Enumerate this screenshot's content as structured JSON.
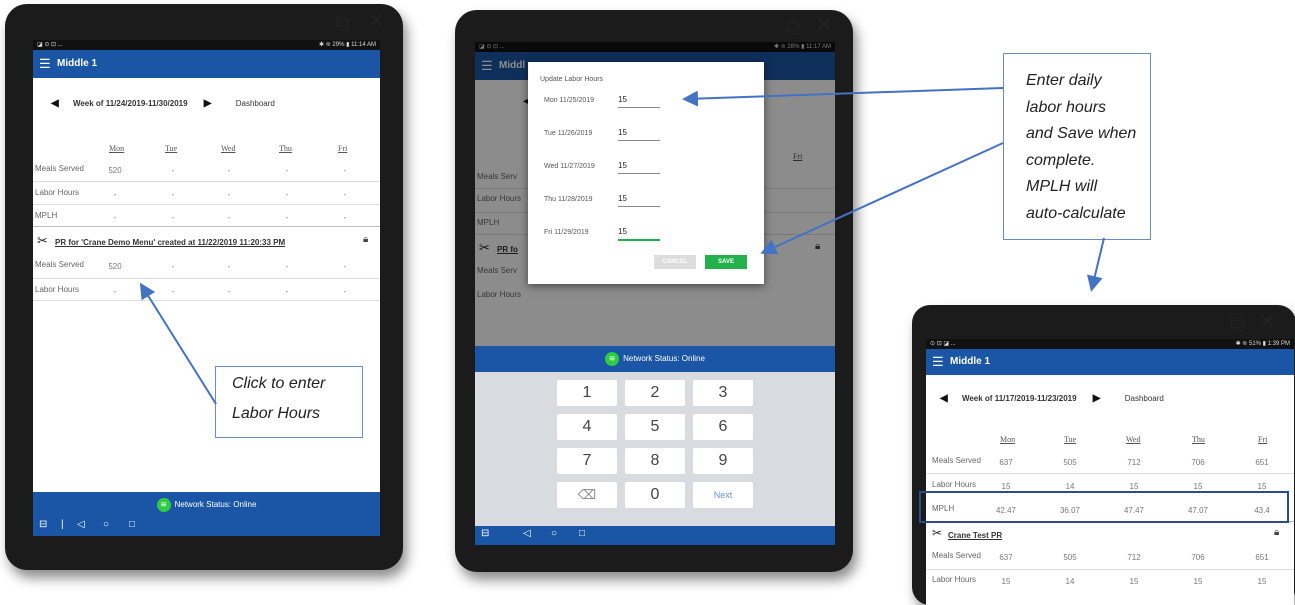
{
  "ext_icon": "external-link-icon",
  "close_icon": "close-x-icon",
  "panel1": {
    "status_left": "◪ ⊙ ⊡ ...",
    "status_right": "✱ ≋ 29% ▮ 11:14 AM",
    "app_title": "Middle 1",
    "week_label": "Week of 11/24/2019-11/30/2019",
    "dashboard": "Dashboard",
    "days": [
      "Mon",
      "Tue",
      "Wed",
      "Thu",
      "Fri"
    ],
    "rows": [
      {
        "label": "Meals Served",
        "values": [
          "520",
          "-",
          "-",
          "-",
          "-"
        ]
      },
      {
        "label": "Labor Hours",
        "values": [
          "-",
          "-",
          "-",
          "-",
          "-"
        ]
      },
      {
        "label": "MPLH",
        "values": [
          "-",
          "-",
          "-",
          "-",
          "-"
        ]
      }
    ],
    "pr_title": "PR for 'Crane Demo Menu' created at 11/22/2019 11:20:33 PM",
    "pr_rows": [
      {
        "label": "Meals Served",
        "values": [
          "520",
          "-",
          "-",
          "-",
          "-"
        ]
      },
      {
        "label": "Labor Hours",
        "values": [
          "-",
          "-",
          "-",
          "-",
          "-"
        ]
      }
    ],
    "network": "Network Status: Online"
  },
  "panel2": {
    "status_left": "◪ ⊙ ⊡ ...",
    "status_right": "✱ ≋ 28% ▮ 11:17 AM",
    "app_title": "Middl",
    "day_fri": "Fri",
    "row_labels": [
      "Meals Serv",
      "Labor Hours",
      "MPLH"
    ],
    "pr_partial": "PR fo",
    "pr_row_labels": [
      "Meals Serv",
      "Labor Hours"
    ],
    "dialog_title": "Update Labor Hours",
    "entries": [
      {
        "date": "Mon 11/25/2019",
        "value": "15"
      },
      {
        "date": "Tue 11/26/2019",
        "value": "15"
      },
      {
        "date": "Wed 11/27/2019",
        "value": "15"
      },
      {
        "date": "Thu 11/28/2019",
        "value": "15"
      },
      {
        "date": "Fri 11/29/2019",
        "value": "15"
      }
    ],
    "cancel": "CANCEL",
    "save": "SAVE",
    "network": "Network Status: Online",
    "keys": [
      "1",
      "2",
      "3",
      "4",
      "5",
      "6",
      "7",
      "8",
      "9",
      "⌫",
      "0",
      "Next"
    ]
  },
  "panel3": {
    "status_left": "⊙ ⊡ ◪ ...",
    "status_right": "✱ ≋ 51% ▮ 1:39 PM",
    "app_title": "Middle 1",
    "week_label": "Week of 11/17/2019-11/23/2019",
    "dashboard": "Dashboard",
    "days": [
      "Mon",
      "Tue",
      "Wed",
      "Thu",
      "Fri"
    ],
    "rows": [
      {
        "label": "Meals Served",
        "values": [
          "637",
          "505",
          "712",
          "706",
          "651"
        ]
      },
      {
        "label": "Labor Hours",
        "values": [
          "15",
          "14",
          "15",
          "15",
          "15"
        ]
      },
      {
        "label": "MPLH",
        "values": [
          "42.47",
          "36.07",
          "47.47",
          "47.07",
          "43.4"
        ]
      }
    ],
    "pr_title": "Crane Test PR",
    "pr_rows": [
      {
        "label": "Meals Served",
        "values": [
          "637",
          "505",
          "712",
          "706",
          "651"
        ]
      },
      {
        "label": "Labor Hours",
        "values": [
          "15",
          "14",
          "15",
          "15",
          "15"
        ]
      }
    ]
  },
  "callouts": {
    "click": [
      "Click to enter",
      "Labor Hours"
    ],
    "enter": [
      "Enter daily",
      "labor hours",
      "and Save when",
      "complete.",
      "MPLH will",
      "auto-calculate"
    ]
  }
}
